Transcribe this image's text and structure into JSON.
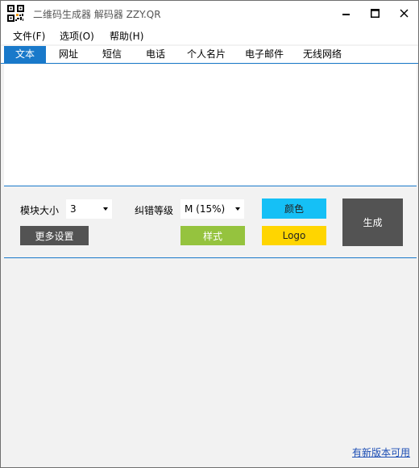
{
  "window": {
    "title": "二维码生成器 解码器 ZZY.QR"
  },
  "menu": {
    "items": [
      {
        "label": "文件(F)"
      },
      {
        "label": "选项(O)"
      },
      {
        "label": "帮助(H)"
      }
    ]
  },
  "tabs": [
    {
      "label": "文本",
      "active": true
    },
    {
      "label": "网址",
      "active": false
    },
    {
      "label": "短信",
      "active": false
    },
    {
      "label": "电话",
      "active": false
    },
    {
      "label": "个人名片",
      "active": false
    },
    {
      "label": "电子邮件",
      "active": false
    },
    {
      "label": "无线网络",
      "active": false
    }
  ],
  "content": {
    "text": ""
  },
  "controls": {
    "module_size_label": "模块大小",
    "module_size_value": "3",
    "ecc_label": "纠错等级",
    "ecc_value": "M (15%)",
    "color_button": "颜色",
    "more_settings_button": "更多设置",
    "style_button": "样式",
    "logo_button": "Logo",
    "generate_button": "生成"
  },
  "footer": {
    "update_link": "有新版本可用"
  },
  "colors": {
    "accent": "#1979ca",
    "color_button": "#15c0f6",
    "style_button": "#95c33e",
    "logo_button": "#ffd500",
    "dark_button": "#535353"
  }
}
